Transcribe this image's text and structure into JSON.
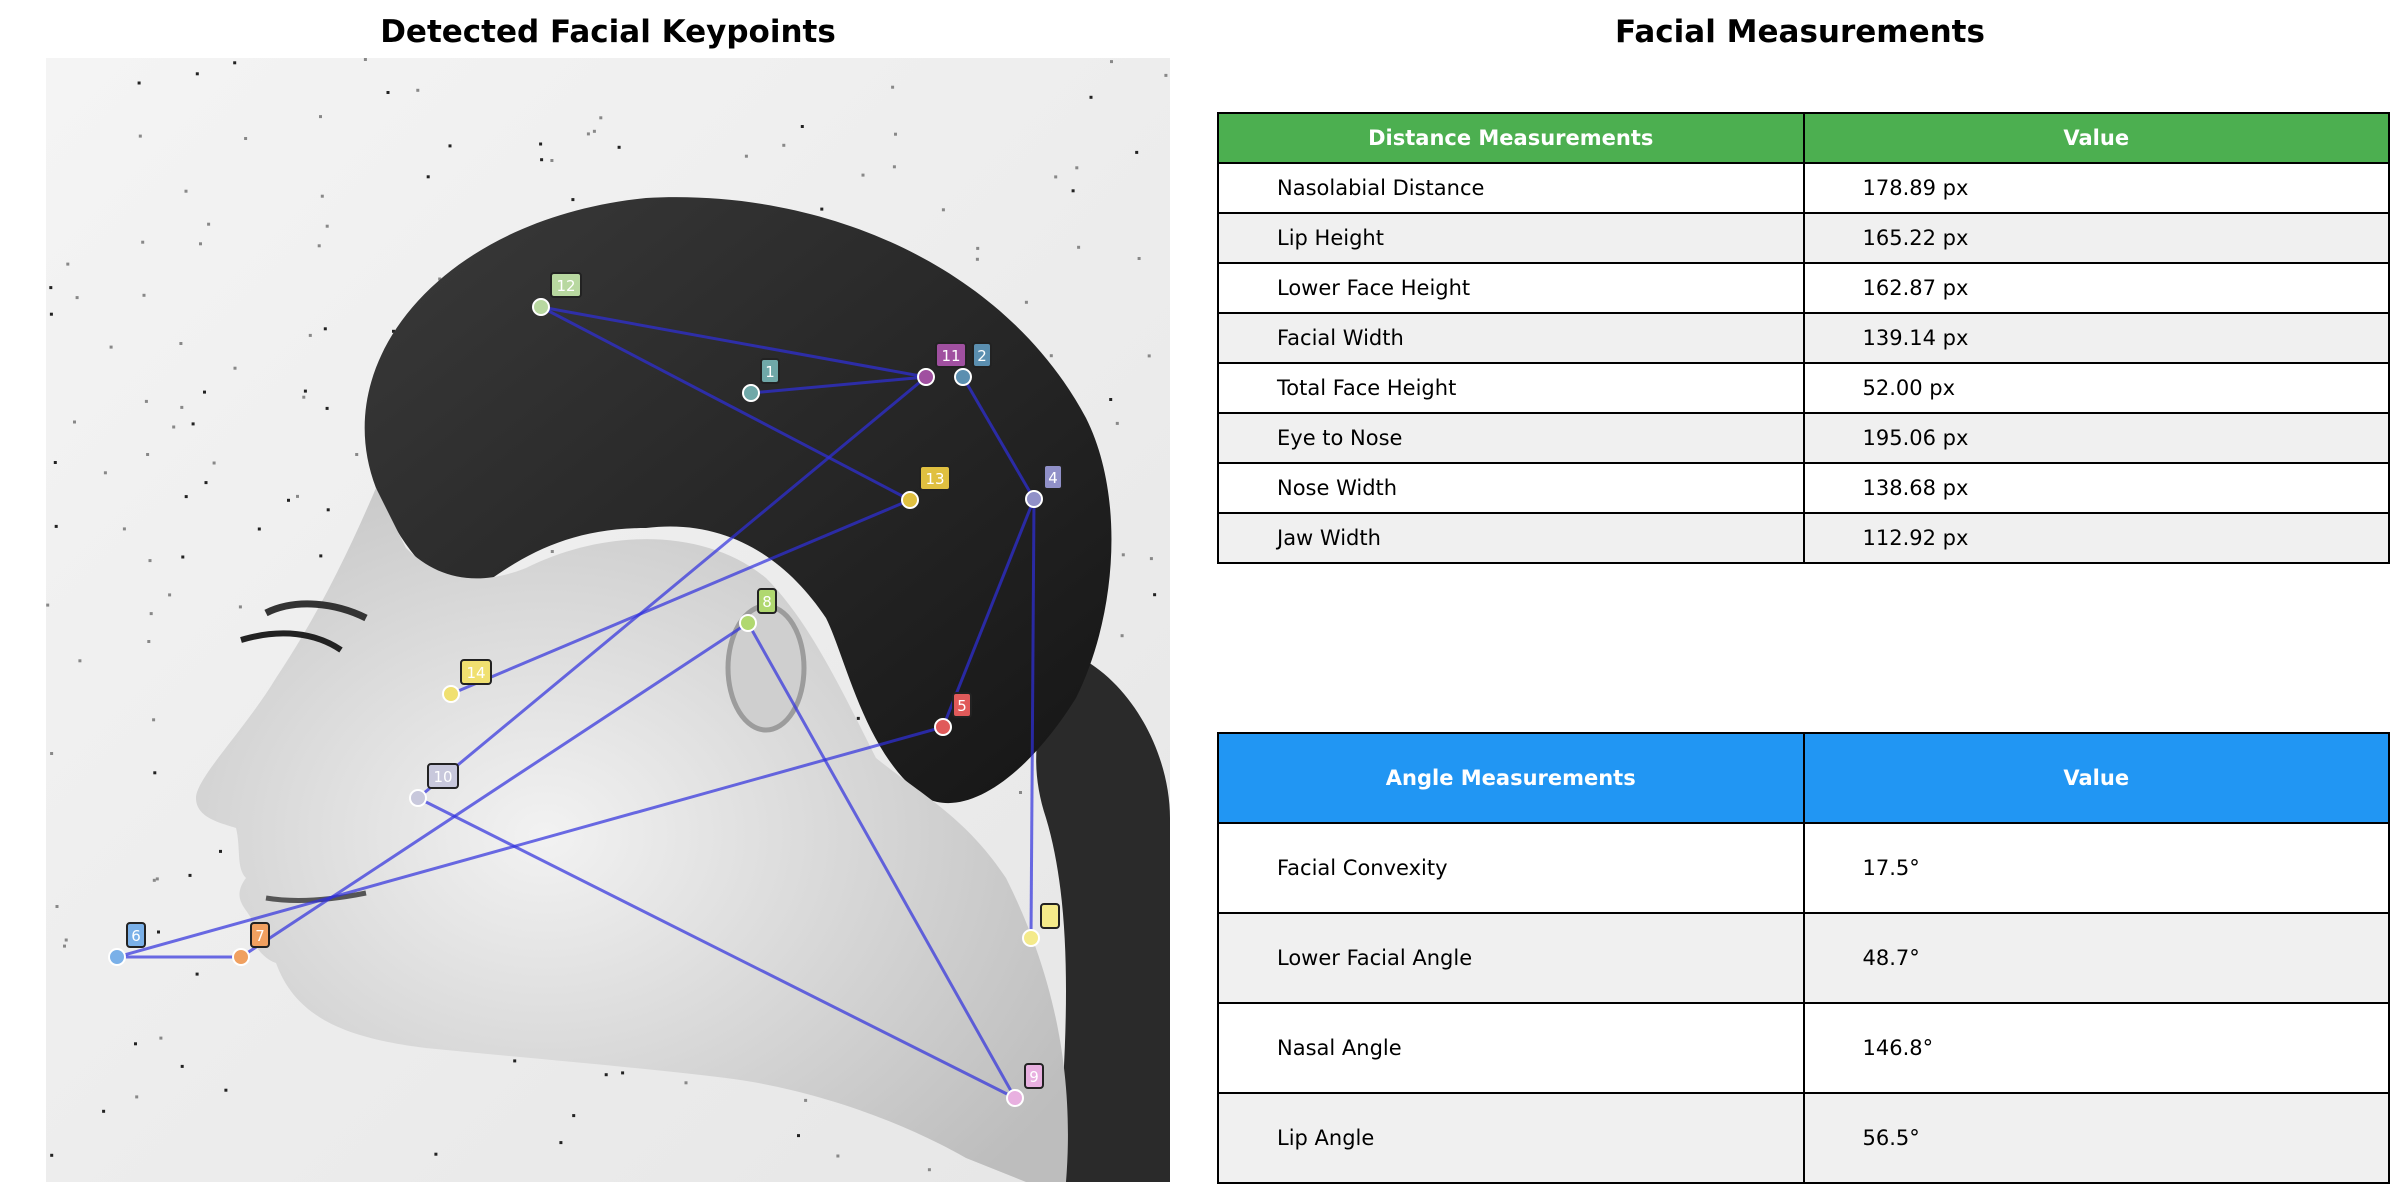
{
  "left_panel": {
    "title": "Detected Facial Keypoints",
    "connections": [
      [
        12,
        11
      ],
      [
        12,
        13
      ],
      [
        1,
        11
      ],
      [
        11,
        10
      ],
      [
        13,
        14
      ],
      [
        2,
        4
      ],
      [
        4,
        5
      ],
      [
        4,
        3
      ],
      [
        5,
        6
      ],
      [
        6,
        7
      ],
      [
        7,
        8
      ],
      [
        8,
        9
      ],
      [
        9,
        10
      ]
    ],
    "keypoints": [
      {
        "id": 1,
        "label": "1",
        "color": "#6fa8a8"
      },
      {
        "id": 2,
        "label": "2",
        "color": "#5b8fb0"
      },
      {
        "id": 3,
        "label": "",
        "color": "#f4ea8a"
      },
      {
        "id": 4,
        "label": "4",
        "color": "#9090c8"
      },
      {
        "id": 5,
        "label": "5",
        "color": "#e05a5a"
      },
      {
        "id": 6,
        "label": "6",
        "color": "#7ab0e8"
      },
      {
        "id": 7,
        "label": "7",
        "color": "#f0a060"
      },
      {
        "id": 8,
        "label": "8",
        "color": "#b0d870"
      },
      {
        "id": 9,
        "label": "9",
        "color": "#e8b0e0"
      },
      {
        "id": 10,
        "label": "10",
        "color": "#c8c8dc"
      },
      {
        "id": 11,
        "label": "11",
        "color": "#a050a0"
      },
      {
        "id": 12,
        "label": "12",
        "color": "#b8d8a0"
      },
      {
        "id": 13,
        "label": "13",
        "color": "#e0c040"
      },
      {
        "id": 14,
        "label": "14",
        "color": "#f0e070"
      }
    ],
    "line_color": "#2f2fdd"
  },
  "right_panel": {
    "title": "Facial Measurements",
    "distance_table": {
      "header_color": "#4caf50",
      "headers": [
        "Distance Measurements",
        "Value"
      ],
      "rows": [
        [
          "Nasolabial Distance",
          "178.89 px"
        ],
        [
          "Lip Height",
          "165.22 px"
        ],
        [
          "Lower Face Height",
          "162.87 px"
        ],
        [
          "Facial Width",
          "139.14 px"
        ],
        [
          "Total Face Height",
          "52.00 px"
        ],
        [
          "Eye to Nose",
          "195.06 px"
        ],
        [
          "Nose Width",
          "138.68 px"
        ],
        [
          "Jaw Width",
          "112.92 px"
        ]
      ]
    },
    "angle_table": {
      "header_color": "#2196f3",
      "headers": [
        "Angle Measurements",
        "Value"
      ],
      "rows": [
        [
          "Facial Convexity",
          "17.5°"
        ],
        [
          "Lower Facial Angle",
          "48.7°"
        ],
        [
          "Nasal Angle",
          "146.8°"
        ],
        [
          "Lip Angle",
          "56.5°"
        ]
      ]
    }
  }
}
